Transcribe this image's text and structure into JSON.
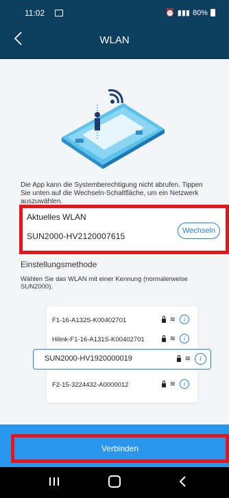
{
  "status_bar": {
    "time": "11:02",
    "battery": "80%",
    "signal_text": "📶"
  },
  "header": {
    "title": "WLAN"
  },
  "notice": "Die App kann die Systemberechtigung nicht abrufen. Tippen Sie unten auf die Wechseln-Schaltfläche, um ein Netzwerk auszuwählen.",
  "current_wlan": {
    "label": "Aktuelles WLAN",
    "ssid": "SUN2000-HV2120007615",
    "switch_label": "Wechseln"
  },
  "method": {
    "title": "Einstellungsmethode",
    "description": "Wählen Sie das WLAN mit einer Kennung (normalerweise SUN2000)."
  },
  "networks": [
    {
      "name": "F1-16-A132S-K00402701"
    },
    {
      "name": "Hilink-F1-16-A131S-K00402701"
    },
    {
      "name": "SUN2000-HV1920000019",
      "selected": true
    },
    {
      "name": "F2-15-3224432-A0000012"
    }
  ],
  "connect_label": "Verbinden",
  "colors": {
    "header": "#0e3e5e",
    "accent": "#2a7fd0",
    "button": "#2a96ec",
    "highlight": "#e8141a"
  }
}
